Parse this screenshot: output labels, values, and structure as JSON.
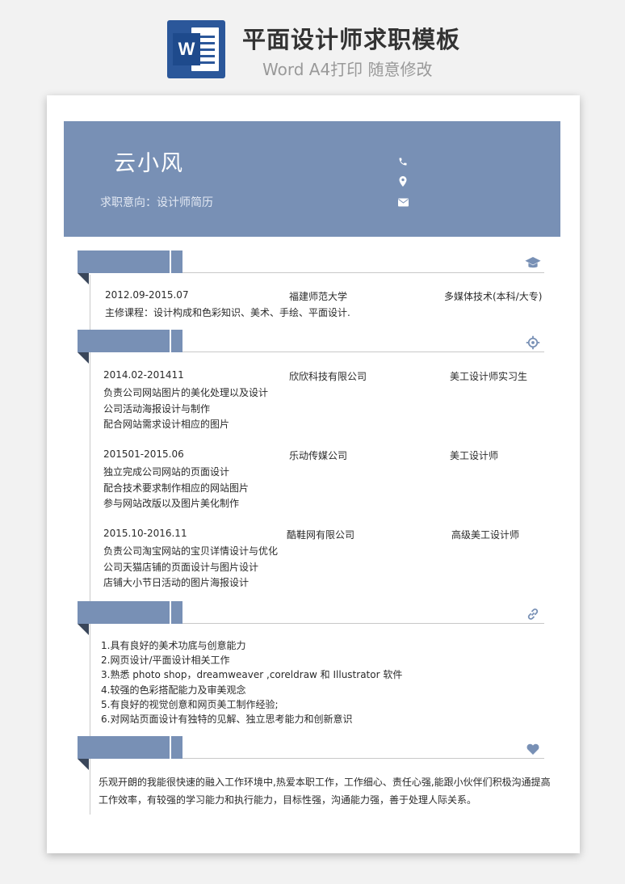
{
  "banner": {
    "title": "平面设计师求职模板",
    "subtitle": "Word A4打印 随意修改",
    "logo_letter": "W"
  },
  "header": {
    "name": "云小风",
    "intent": "求职意向：设计师简历",
    "icons": [
      "phone-icon",
      "location-icon",
      "mail-icon"
    ]
  },
  "colors": {
    "accent": "#7890b5",
    "accent_dark": "#39465a"
  },
  "education": {
    "icon": "graduation-cap-icon",
    "entry": {
      "period": "2012.09-2015.07",
      "school": "福建师范大学",
      "major": "多媒体技术(本科/大专)"
    },
    "courses": "主修课程：设计构成和色彩知识、美术、手绘、平面设计."
  },
  "experience": {
    "icon": "crosshair-icon",
    "jobs": [
      {
        "period": "2014.02-201411",
        "company": "欣欣科技有限公司",
        "title": "美工设计师实习生",
        "duties": [
          "负责公司网站图片的美化处理以及设计",
          "公司活动海报设计与制作",
          "配合网站需求设计相应的图片"
        ]
      },
      {
        "period": "201501-2015.06",
        "company": "乐动传媒公司",
        "title": "美工设计师",
        "duties": [
          "独立完成公司网站的页面设计",
          "配合技术要求制作相应的网站图片",
          "参与网站改版以及图片美化制作"
        ]
      },
      {
        "period": "2015.10-2016.11",
        "company": "酷鞋网有限公司",
        "title": "高级美工设计师",
        "duties": [
          "负责公司淘宝网站的宝贝详情设计与优化",
          "公司天猫店铺的页面设计与图片设计",
          "店铺大小节日活动的图片海报设计"
        ]
      }
    ]
  },
  "skills": {
    "icon": "link-icon",
    "items": [
      "1.具有良好的美术功底与创意能力",
      "2.网页设计/平面设计相关工作",
      "3.熟悉 photo shop，dreamweaver ,coreldraw 和 Illustrator 软件",
      "4.较强的色彩搭配能力及审美观念",
      "5.有良好的视觉创意和网页美工制作经验;",
      "6.对网站页面设计有独特的见解、独立思考能力和创新意识"
    ]
  },
  "self_eval": {
    "icon": "heart-icon",
    "text": "乐观开朗的我能很快速的融入工作环境中,热爱本职工作，工作细心、责任心强,能跟小伙伴们积极沟通提高工作效率，有较强的学习能力和执行能力，目标性强，沟通能力强，善于处理人际关系。"
  }
}
